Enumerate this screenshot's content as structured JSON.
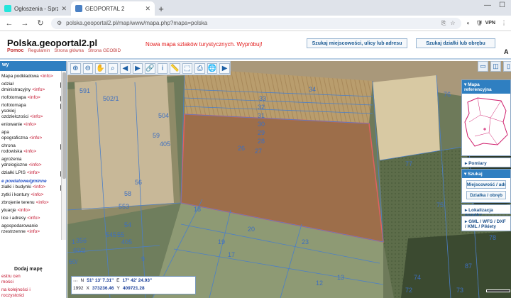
{
  "browser": {
    "tabs": [
      {
        "title": "Ogłoszenia - Sprzedam, kupię i",
        "favicon_color": "#23e5db"
      },
      {
        "title": "GEOPORTAL 2",
        "favicon_color": "#4a80c4"
      }
    ],
    "new_tab": "+",
    "url": "polska.geoportal2.pl/map/www/mapa.php?mapa=polska",
    "vpn_label": "VPN",
    "window_controls": {
      "minimize": "—",
      "maximize": "☐"
    }
  },
  "site": {
    "logo": "Polska.geoportal2.pl",
    "links": {
      "pomoc": "Pomoc",
      "regulamin": "Regulamin",
      "strona_glowna": "Strona główna",
      "strona_geobid": "Strona GEOBID"
    },
    "promo": "Nowa mapa szlaków turystycznych. Wypróbuj!",
    "search_place_button": "Szukaj miejscowości, ulicy lub adresu",
    "search_parcel_button": "Szukaj działki lub obrębu",
    "edge_letter": "A"
  },
  "layers_panel": {
    "header": "wy",
    "info_label": "<info>",
    "layers": [
      {
        "label": "Mapa podkładowa",
        "pdf": false
      },
      {
        "label": "odział\ndministracyjny",
        "pdf": true
      },
      {
        "label": "rtofotomapa",
        "pdf": true
      },
      {
        "label": "rtofotomapa\nysokiej\nozdzielczości",
        "pdf": true
      },
      {
        "label": "eniowanie",
        "pdf": false
      },
      {
        "label": "apa\nopograficzna",
        "pdf": false
      },
      {
        "label": "chrona\nrodowiska",
        "pdf": true
      },
      {
        "label": "agrożenia\nydrologiczne",
        "pdf": false
      },
      {
        "label": "działki LPIS",
        "pdf": true
      }
    ],
    "section_label": "e powiatowe/gminne",
    "layers2": [
      {
        "label": "ziałki i budynki",
        "pdf": true
      },
      {
        "label": "zytki i kontury",
        "pdf": false
      },
      {
        "label": "zbrojenie terenu",
        "pdf": false
      },
      {
        "label": "ytuacje",
        "pdf": false
      },
      {
        "label": "lice i adresy",
        "pdf": false
      },
      {
        "label": "agospodarowanie\nrzestrzenne",
        "pdf": false
      }
    ],
    "add_map": "Dodaj mapę",
    "bottom_links": [
      "estru cen\nmości",
      "na kolejności i\nroczystości"
    ]
  },
  "map": {
    "toolbar": [
      "zoom-in",
      "zoom-out",
      "pan",
      "zoom-box",
      "back",
      "forward",
      "link",
      "info",
      "measure",
      "area",
      "print",
      "globe",
      "video"
    ],
    "labels": [
      "34",
      "591",
      "502/1",
      "504",
      "59",
      "405",
      "33",
      "32",
      "31",
      "30",
      "29",
      "28",
      "26",
      "27",
      "56",
      "58",
      "553",
      "54",
      "55",
      "545",
      "405",
      "356",
      "60/2",
      "60/",
      "18",
      "19",
      "20",
      "17",
      "9",
      "12",
      "13",
      "23",
      "76",
      "77",
      "75",
      "78",
      "87",
      "74",
      "72",
      "73",
      "71",
      "70",
      "68",
      "1"
    ],
    "coordinates": {
      "lat_label": "N",
      "lat": "51° 13' 7.31\"",
      "lon_label": "E",
      "lon": "17° 42' 24.93\"",
      "x_label": "X",
      "x": "373236.46",
      "y_label": "Y",
      "y": "409721.28",
      "epsg": "1992"
    }
  },
  "right_panel": {
    "ref_map_title": "Mapa referencyjna",
    "pomiary": "Pomiary",
    "szukaj": "Szukaj",
    "miejscowosc_btn": "Miejscowość / adr",
    "dzialka_btn": "Działka / obręb",
    "lokalizacja": "Lokalizacja współrz",
    "gml": "GML / WFS / DXF / KML / Pikiety"
  }
}
